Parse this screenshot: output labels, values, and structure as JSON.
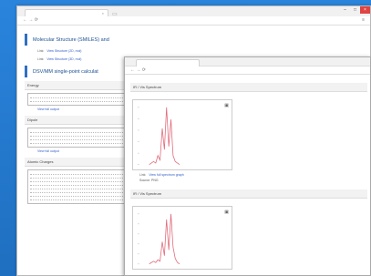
{
  "back_window": {
    "tab_title": "",
    "sections": [
      {
        "title": "Molecular Structure (SMILES) and",
        "link_label": "Link:",
        "link_text": "View Structure (2D, mol)",
        "link2_text": "View Structure (3D, mol)"
      },
      {
        "title": "DSV/MM single-point calculat"
      }
    ],
    "boxes": [
      {
        "title": "Energy",
        "link": "View full output"
      },
      {
        "title": "Dipole",
        "link": "View full output"
      },
      {
        "title": "Atomic Charges"
      }
    ]
  },
  "front_window": {
    "tab_title": "",
    "sections": [
      {
        "title": "IR / Vis Spectrum",
        "link_label": "Link:",
        "link_text": "View full spectrum graph",
        "note": "Source: PNG"
      },
      {
        "title": "IR / Vis Spectrum"
      }
    ]
  },
  "chart_data": [
    {
      "type": "line",
      "title": "",
      "series": [
        {
          "values": [
            0,
            1,
            2,
            1,
            6,
            3,
            24,
            10,
            38,
            12,
            30,
            6,
            2,
            1,
            0
          ]
        }
      ]
    },
    {
      "type": "line",
      "title": "",
      "series": [
        {
          "values": [
            0,
            1,
            2,
            1,
            3,
            2,
            16,
            6,
            32,
            10,
            36,
            12,
            4,
            1,
            0
          ]
        }
      ]
    }
  ],
  "colors": {
    "desktop": "#2a84dc",
    "accent": "#2f6fc3",
    "close": "#e04343",
    "line": "#e06a7a"
  }
}
